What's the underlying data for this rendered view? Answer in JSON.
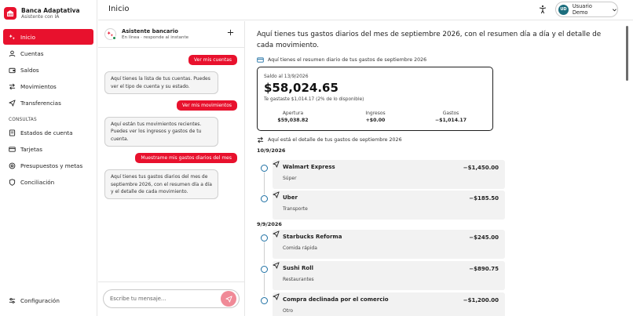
{
  "brand": {
    "title": "Banca Adaptativa",
    "subtitle": "Asistente con IA"
  },
  "sidebar": {
    "items": [
      {
        "label": "Inicio",
        "icon": "sparkle-icon",
        "active": true
      },
      {
        "label": "Cuentas",
        "icon": "user-icon"
      },
      {
        "label": "Saldos",
        "icon": "wallet-icon"
      },
      {
        "label": "Movimientos",
        "icon": "swap-icon"
      },
      {
        "label": "Transferencias",
        "icon": "send-icon"
      }
    ],
    "section_label": "CONSULTAS",
    "consultas": [
      {
        "label": "Estados de cuenta",
        "icon": "document-icon"
      },
      {
        "label": "Tarjetas",
        "icon": "card-icon"
      },
      {
        "label": "Presupuestos y metas",
        "icon": "target-icon"
      },
      {
        "label": "Conciliación",
        "icon": "shield-icon"
      }
    ],
    "settings_label": "Configuración"
  },
  "header": {
    "title": "Inicio",
    "user_initials": "UD",
    "user_name": "Usuario Demo"
  },
  "chat": {
    "name": "Asistente bancario",
    "status": "En línea · responde al instante",
    "input_placeholder": "Escribe tu mensaje...",
    "messages": [
      {
        "role": "user",
        "text": "Ver mis cuentas"
      },
      {
        "role": "bot",
        "text": "Aquí tienes la lista de tus cuentas. Puedes ver el tipo de cuenta y su estado."
      },
      {
        "role": "user",
        "text": "Ver mis movimientos"
      },
      {
        "role": "bot",
        "text": "Aquí están tus movimientos recientes. Puedes ver los ingresos y gastos de tu cuenta."
      },
      {
        "role": "user",
        "text": "Muestrame mis gastos diarios del mes"
      },
      {
        "role": "bot",
        "text": "Aquí tienes tus gastos diarios del mes de septiembre 2026, con el resumen día a día y el detalle de cada movimiento."
      }
    ]
  },
  "main": {
    "intro": "Aquí tienes tus gastos diarios del mes de septiembre 2026, con el resumen día a día y el detalle de cada movimiento.",
    "summary_caption": "Aquí tienes el resumen diario de tus gastos de septiembre 2026",
    "summary": {
      "balance_label": "Saldo al 13/9/2026",
      "balance": "$58,024.65",
      "note": "Te gastaste $1,014.17 (2% de lo disponible)",
      "columns": [
        {
          "label": "Apertura",
          "value": "$59,038.82"
        },
        {
          "label": "Ingresos",
          "value": "+$0.00"
        },
        {
          "label": "Gastos",
          "value": "−$1,014.17"
        }
      ]
    },
    "detail_caption": "Aquí está el detalle de tus gastos de septiembre 2026",
    "days": [
      {
        "date": "10/9/2026",
        "transactions": [
          {
            "name": "Walmart Express",
            "category": "Súper",
            "amount": "−$1,450.00"
          },
          {
            "name": "Uber",
            "category": "Transporte",
            "amount": "−$185.50"
          }
        ]
      },
      {
        "date": "9/9/2026",
        "transactions": [
          {
            "name": "Starbucks Reforma",
            "category": "Comida rápida",
            "amount": "−$245.00"
          },
          {
            "name": "Sushi Roll",
            "category": "Restaurantes",
            "amount": "−$890.75"
          },
          {
            "name": "Compra declinada por el comercio",
            "category": "Otro",
            "amount": "−$1,200.00"
          }
        ]
      }
    ]
  },
  "colors": {
    "accent": "#e8112d",
    "avatar": "#1b6d7d",
    "online": "#1a8a4a",
    "timeline": "#1d6fa3"
  }
}
